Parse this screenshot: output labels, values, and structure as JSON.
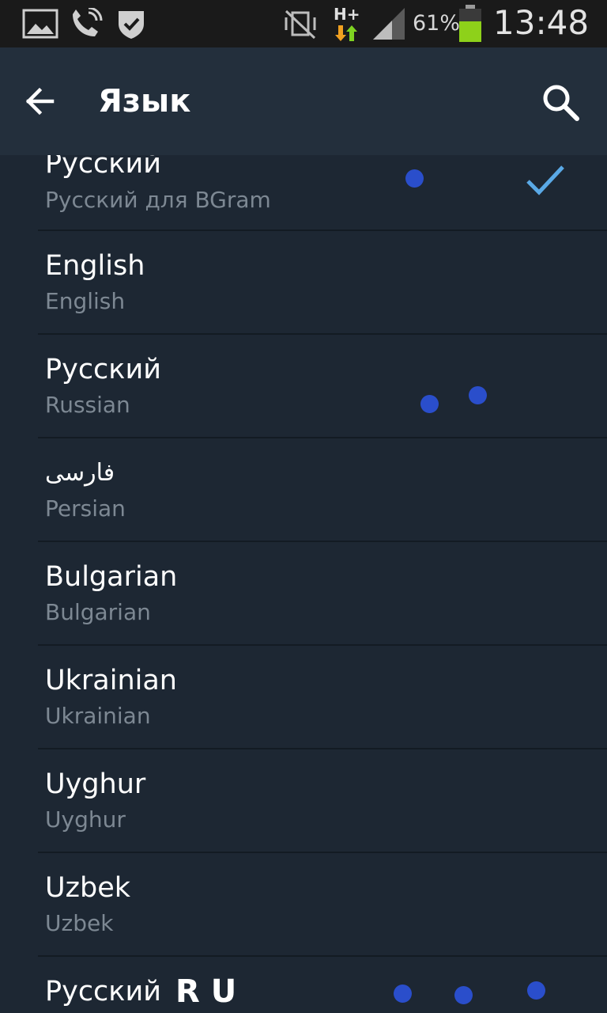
{
  "status_bar": {
    "battery_percent": "61%",
    "battery_level": 0.61,
    "network_type": "H+",
    "time": "13:48",
    "icons": [
      "gallery-icon",
      "call-icon",
      "shield-icon",
      "vibrate-mute-icon",
      "network-data-icon",
      "signal-icon",
      "battery-icon"
    ]
  },
  "action_bar": {
    "title": "Язык",
    "back_icon": "arrow-back-icon",
    "search_icon": "search-icon"
  },
  "languages": [
    {
      "name": "Русский",
      "subtitle": "Русский для BGram",
      "selected": true
    },
    {
      "name": "English",
      "subtitle": "English",
      "selected": false
    },
    {
      "name": "Русский",
      "subtitle": "Russian",
      "selected": false
    },
    {
      "name": "فارسی",
      "subtitle": "Persian",
      "selected": false
    },
    {
      "name": "Bulgarian",
      "subtitle": "Bulgarian",
      "selected": false
    },
    {
      "name": "Ukrainian",
      "subtitle": "Ukrainian",
      "selected": false
    },
    {
      "name": "Uyghur",
      "subtitle": "Uyghur",
      "selected": false
    },
    {
      "name": "Uzbek",
      "subtitle": "Uzbek",
      "selected": false
    },
    {
      "name": "Русский",
      "subtitle": "",
      "selected": false,
      "badge": "R U"
    }
  ],
  "colors": {
    "background": "#1d2733",
    "action_bar": "#232f3c",
    "accent_check": "#5aa9e6",
    "overlay_dot": "#2a4ecb",
    "battery": "#8ed11a"
  }
}
